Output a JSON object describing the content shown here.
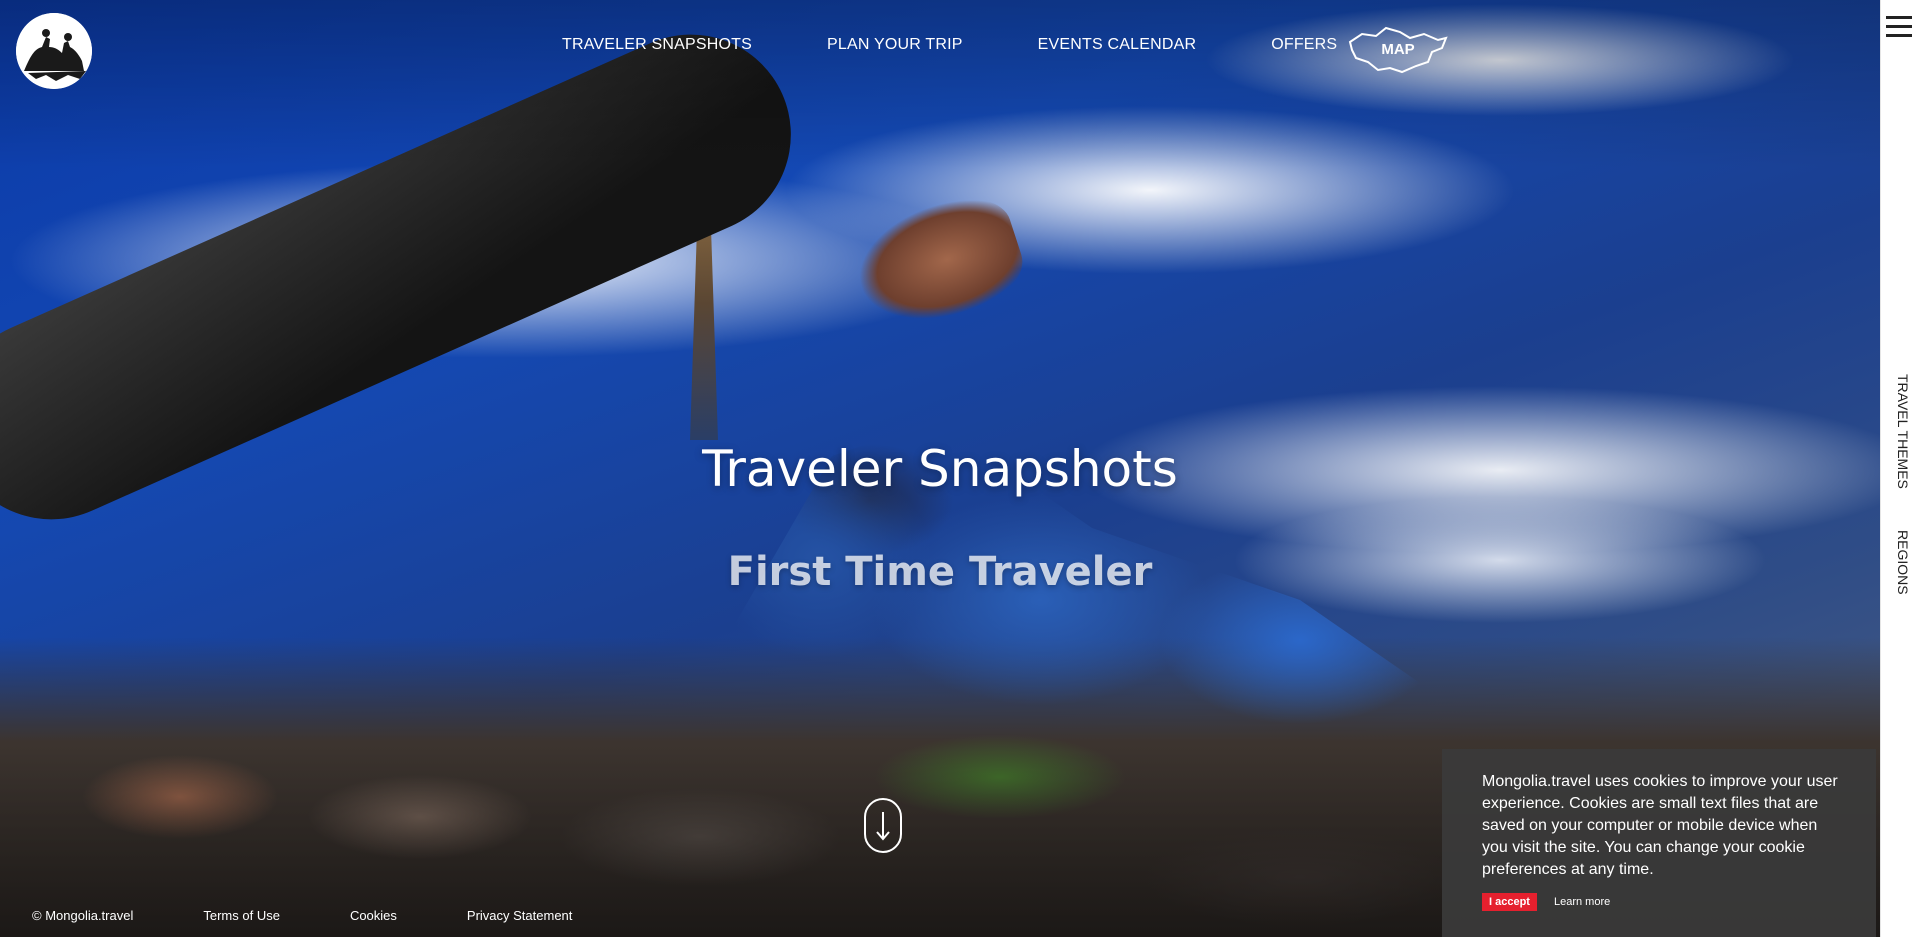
{
  "nav": {
    "items": [
      {
        "label": "TRAVELER SNAPSHOTS"
      },
      {
        "label": "PLAN YOUR TRIP"
      },
      {
        "label": "EVENTS CALENDAR"
      },
      {
        "label": "OFFERS"
      }
    ],
    "map_label": "MAP"
  },
  "rail": {
    "links": [
      {
        "label": "TRAVEL THEMES"
      },
      {
        "label": "REGIONS"
      }
    ]
  },
  "hero": {
    "title": "Traveler Snapshots",
    "subtitle": "First Time Traveler"
  },
  "footer": {
    "copyright": "© Mongolia.travel",
    "links": [
      {
        "label": "Terms of Use"
      },
      {
        "label": "Cookies"
      },
      {
        "label": "Privacy Statement"
      }
    ]
  },
  "cookie": {
    "text": "Mongolia.travel uses cookies to improve your user experience. Cookies are small text files that are saved on your computer or mobile device when you visit the site. You can change your cookie preferences at any time.",
    "accept_label": "I accept",
    "learn_more_label": "Learn more",
    "accept_color": "#e5202e"
  },
  "icons": {
    "logo": "horse-riders-logo",
    "menu": "hamburger-icon",
    "map": "mongolia-map-outline-icon",
    "scroll": "arrow-down-icon"
  }
}
